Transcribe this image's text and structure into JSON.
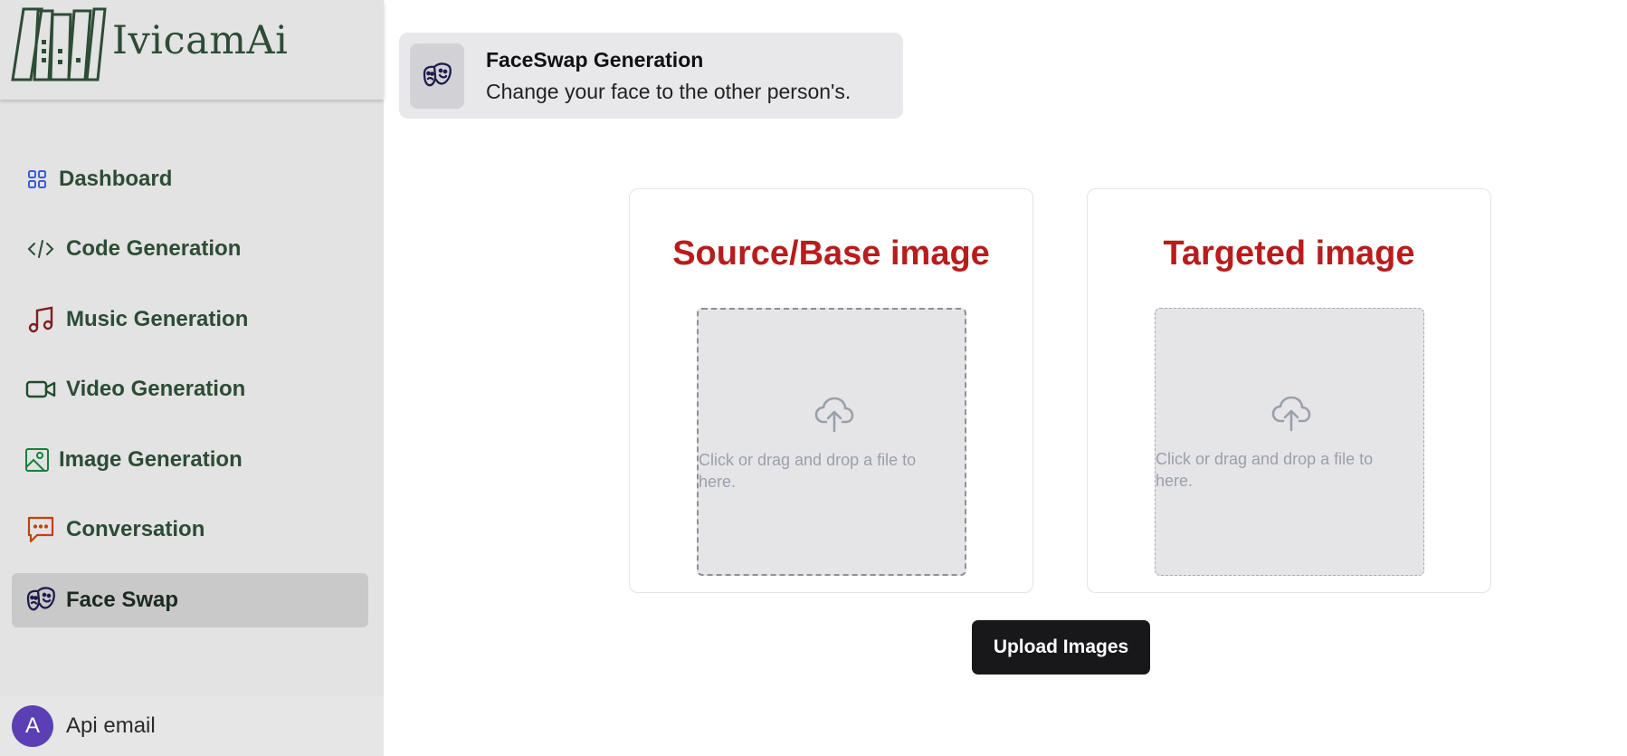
{
  "sidebar": {
    "logo_text": "IvicamAi",
    "items": [
      {
        "label": "Dashboard",
        "icon": "grid-icon",
        "color": "#3b5bdb"
      },
      {
        "label": "Code Generation",
        "icon": "code-icon",
        "color": "#2c4c35"
      },
      {
        "label": "Music Generation",
        "icon": "music-icon",
        "color": "#7f1d1d"
      },
      {
        "label": "Video Generation",
        "icon": "video-icon",
        "color": "#1f4d2b"
      },
      {
        "label": "Image Generation",
        "icon": "image-icon",
        "color": "#15803d"
      },
      {
        "label": "Conversation",
        "icon": "message-icon",
        "color": "#c2410c"
      },
      {
        "label": "Face Swap",
        "icon": "masks-icon",
        "color": "#1e1b4b",
        "active": true
      }
    ],
    "user": {
      "initial": "A",
      "name": "Api email"
    }
  },
  "header": {
    "title": "FaceSwap Generation",
    "subtitle": "Change your face to the other person's.",
    "icon": "masks-icon"
  },
  "main": {
    "source": {
      "title": "Source/Base image",
      "drop_text": "Click or drag and drop a file to here."
    },
    "target": {
      "title": "Targeted image",
      "drop_text": "Click or drag and drop a file to here."
    },
    "upload_label": "Upload Images"
  },
  "colors": {
    "accent_title": "#b91c1c",
    "sidebar_text": "#2c4c35",
    "button_bg": "#18181b"
  }
}
